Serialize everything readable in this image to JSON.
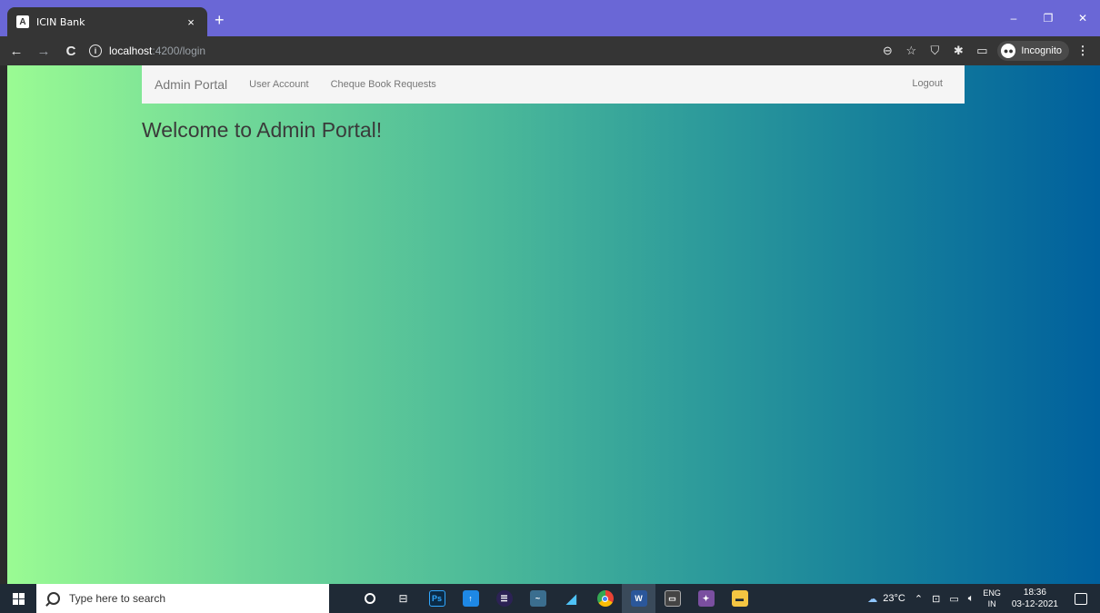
{
  "browser": {
    "tab_title": "ICIN Bank",
    "tab_favicon": "A",
    "tab_close": "×",
    "new_tab": "+",
    "url_host": "localhost",
    "url_path": ":4200/login",
    "incognito_label": "Incognito",
    "window_minimize": "–",
    "window_restore": "❐",
    "window_close": "✕"
  },
  "navbar": {
    "brand": "Admin Portal",
    "links": [
      {
        "label": "User Account"
      },
      {
        "label": "Cheque Book Requests"
      }
    ],
    "logout": "Logout"
  },
  "main": {
    "heading": "Welcome to Admin Portal!"
  },
  "taskbar": {
    "search_placeholder": "Type here to search",
    "weather": "23°C",
    "lang_top": "ENG",
    "lang_bottom": "IN",
    "time": "18:36",
    "date": "03-12-2021"
  },
  "colors": {
    "title_bar": "#6a67d6",
    "toolbar": "#353535",
    "gradient_start": "#9afb93",
    "gradient_end": "#00609d",
    "navbar": "#f5f5f5",
    "taskbar": "#1f2a36"
  }
}
